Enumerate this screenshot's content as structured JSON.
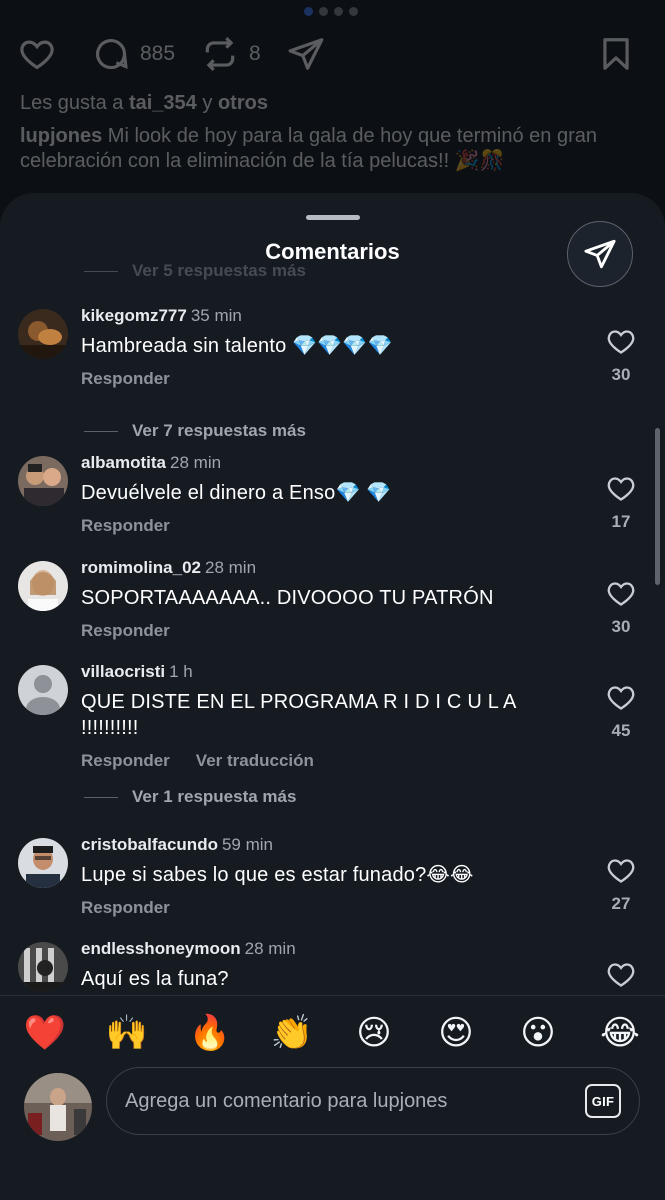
{
  "post": {
    "comment_count": "885",
    "repost_count": "8",
    "likes_prefix": "Les gusta a ",
    "likes_user": "tai_354",
    "likes_and": " y ",
    "likes_others": "otros",
    "caption_user": "lupjones",
    "caption_text": " Mi look de hoy para la gala de hoy que terminó en gran celebración con la eliminación de la tía pelucas!! 🎉🎊"
  },
  "sheet": {
    "title": "Comentarios",
    "faded_replies": "Ver 5 respuestas más"
  },
  "comments": [
    {
      "user": "kikegomz777",
      "time": "35 min",
      "text": "Hambreada sin talento 💎💎💎💎",
      "reply": "Responder",
      "likes": "30",
      "view_more": "Ver 7 respuestas más"
    },
    {
      "user": "albamotita",
      "time": "28 min",
      "text": "Devuélvele el dinero a Enso💎 💎",
      "reply": "Responder",
      "likes": "17"
    },
    {
      "user": "romimolina_02",
      "time": "28 min",
      "text": "SOPORTAAAAAAA.. DIVOOOO TU PATRÓN",
      "reply": "Responder",
      "likes": "30"
    },
    {
      "user": "villaocristi",
      "time": "1 h",
      "text": "QUE DISTE EN EL PROGRAMA R I D I C U L A !!!!!!!!!!",
      "reply": "Responder",
      "translate": "Ver traducción",
      "likes": "45",
      "view_more": "Ver 1 respuesta más"
    },
    {
      "user": "cristobalfacundo",
      "time": "59 min",
      "text": "Lupe si sabes lo que es estar funado?😂😂",
      "reply": "Responder",
      "likes": "27"
    },
    {
      "user": "endlesshoneymoon",
      "time": "28 min",
      "text": "Aquí es la funa?",
      "reply": "",
      "likes": ""
    }
  ],
  "quick_reactions": [
    "❤️",
    "🙌",
    "🔥",
    "👏",
    "😢",
    "😍",
    "😮",
    "😂"
  ],
  "composer": {
    "placeholder": "Agrega un comentario para lupjones",
    "gif_label": "GIF"
  }
}
